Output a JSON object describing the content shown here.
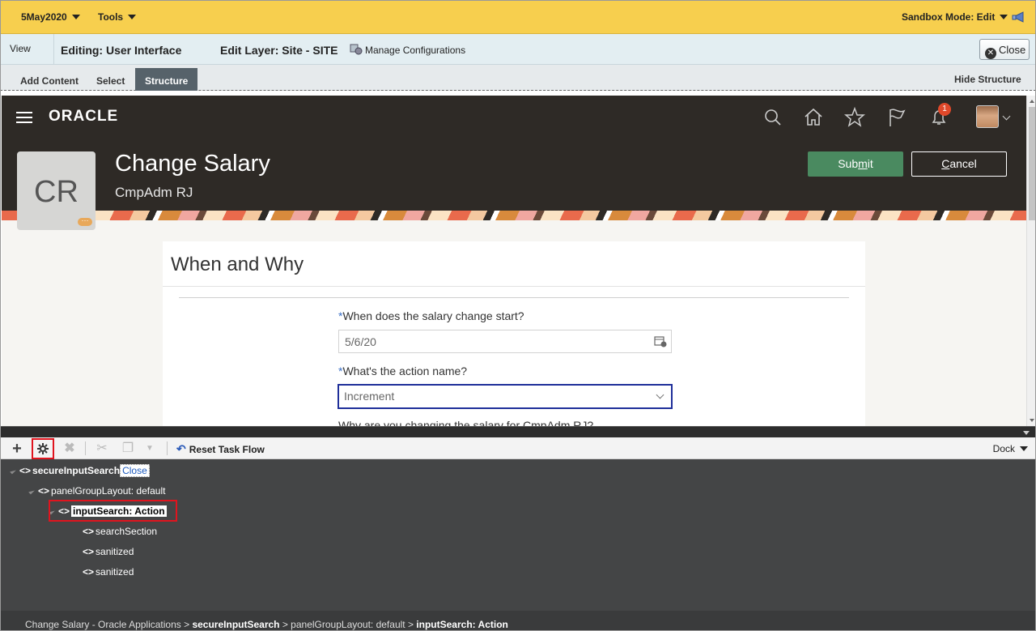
{
  "topbar": {
    "date_menu": "5May2020",
    "tools_menu": "Tools",
    "sandbox_mode": "Sandbox Mode: Edit"
  },
  "editbar": {
    "view": "View",
    "editing": "Editing: User Interface",
    "edit_layer": "Edit Layer: Site - SITE",
    "manage_configurations": "Manage Configurations",
    "close": "Close"
  },
  "tabs": {
    "add_content": "Add Content",
    "select": "Select",
    "structure": "Structure",
    "hide_structure": "Hide Structure"
  },
  "app": {
    "logo": "ORACLE",
    "notification_count": "1",
    "initials": "CR",
    "initials_dots": "···",
    "page_title": "Change Salary",
    "person_name": "CmpAdm RJ",
    "submit_prefix": "Sub",
    "submit_underlined": "m",
    "submit_suffix": "it",
    "cancel_underlined": "C",
    "cancel_suffix": "ancel",
    "section_title": "When and Why",
    "required_mark": "*",
    "field1_label": "When does the salary change start?",
    "field1_value": "5/6/20",
    "field2_label": "What's the action name?",
    "field2_value": "Increment",
    "field3_label_cut": "Why are you changing the salary for CmpAdm RJ?"
  },
  "structure_toolbar": {
    "add_icon": "plus-icon",
    "props_icon": "properties-gear-icon",
    "delete_icon": "delete-x-icon",
    "cut_icon": "cut-icon",
    "copy_icon": "copy-icon",
    "reset_task_flow": "Reset Task Flow",
    "dock": "Dock"
  },
  "tree": {
    "root": {
      "name": "secureInputSearch",
      "close_label": "Close"
    },
    "panel": "panelGroupLayout: default",
    "selected": "inputSearch: Action",
    "children": [
      "searchSection",
      "sanitized",
      "sanitized"
    ]
  },
  "status": {
    "p1": "Change Salary - Oracle Applications > ",
    "p2": "secureInputSearch",
    "p3": " > panelGroupLayout: default > ",
    "p4": "inputSearch: Action"
  },
  "colors": {
    "topbar": "#f7cf4e",
    "editbar": "#e3eef2",
    "app_header": "#2e2a26",
    "submit": "#4a8a60",
    "tree_bg": "#444546",
    "highlight_red": "#e0141e",
    "focus_border": "#1f2f9a"
  }
}
